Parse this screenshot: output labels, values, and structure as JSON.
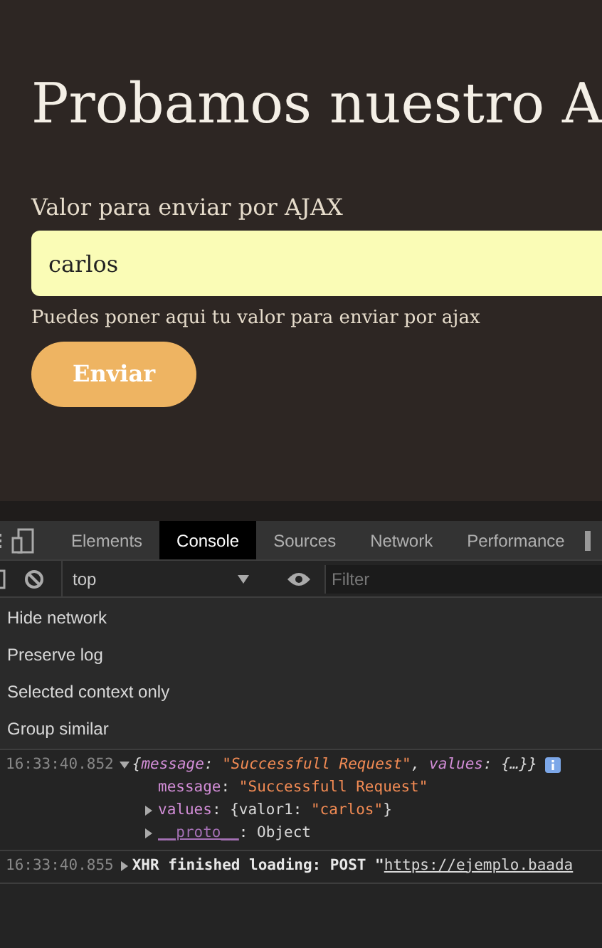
{
  "page": {
    "title": "Probamos nuestro A",
    "field_label": "Valor para enviar por AJAX",
    "field_value": "carlos",
    "help": "Puedes poner aqui tu valor para enviar por ajax",
    "button": "Enviar"
  },
  "devtools": {
    "tabs": [
      {
        "label": "Elements",
        "selected": false
      },
      {
        "label": "Console",
        "selected": true
      },
      {
        "label": "Sources",
        "selected": false
      },
      {
        "label": "Network",
        "selected": false
      },
      {
        "label": "Performance",
        "selected": false
      }
    ],
    "context": "top",
    "filter_placeholder": "Filter",
    "settings": [
      "Hide network",
      "Preserve log",
      "Selected context only",
      "Group similar"
    ],
    "logs": [
      {
        "time": "16:33:40.852",
        "expanded": true,
        "summary": [
          {
            "kind": "punct",
            "text": "{"
          },
          {
            "kind": "key",
            "text": "message"
          },
          {
            "kind": "punct",
            "text": ": "
          },
          {
            "kind": "string",
            "text": "\"Successfull Request\""
          },
          {
            "kind": "punct",
            "text": ", "
          },
          {
            "kind": "key",
            "text": "values"
          },
          {
            "kind": "punct",
            "text": ": {…}}"
          }
        ],
        "children": [
          {
            "expandable": false,
            "parts": [
              {
                "kind": "key",
                "text": "message"
              },
              {
                "kind": "punct",
                "text": ": "
              },
              {
                "kind": "string",
                "text": "\"Successfull Request\""
              }
            ]
          },
          {
            "expandable": true,
            "parts": [
              {
                "kind": "key",
                "text": "values"
              },
              {
                "kind": "punct",
                "text": ": {valor1: "
              },
              {
                "kind": "string",
                "text": "\"carlos\""
              },
              {
                "kind": "punct",
                "text": "}"
              }
            ]
          },
          {
            "expandable": true,
            "parts": [
              {
                "kind": "proto",
                "text": "__proto__"
              },
              {
                "kind": "punct",
                "text": ": Object"
              }
            ]
          }
        ]
      },
      {
        "time": "16:33:40.855",
        "expanded": false,
        "text": "XHR finished loading: POST \"",
        "link": "https://ejemplo.baada"
      }
    ]
  }
}
